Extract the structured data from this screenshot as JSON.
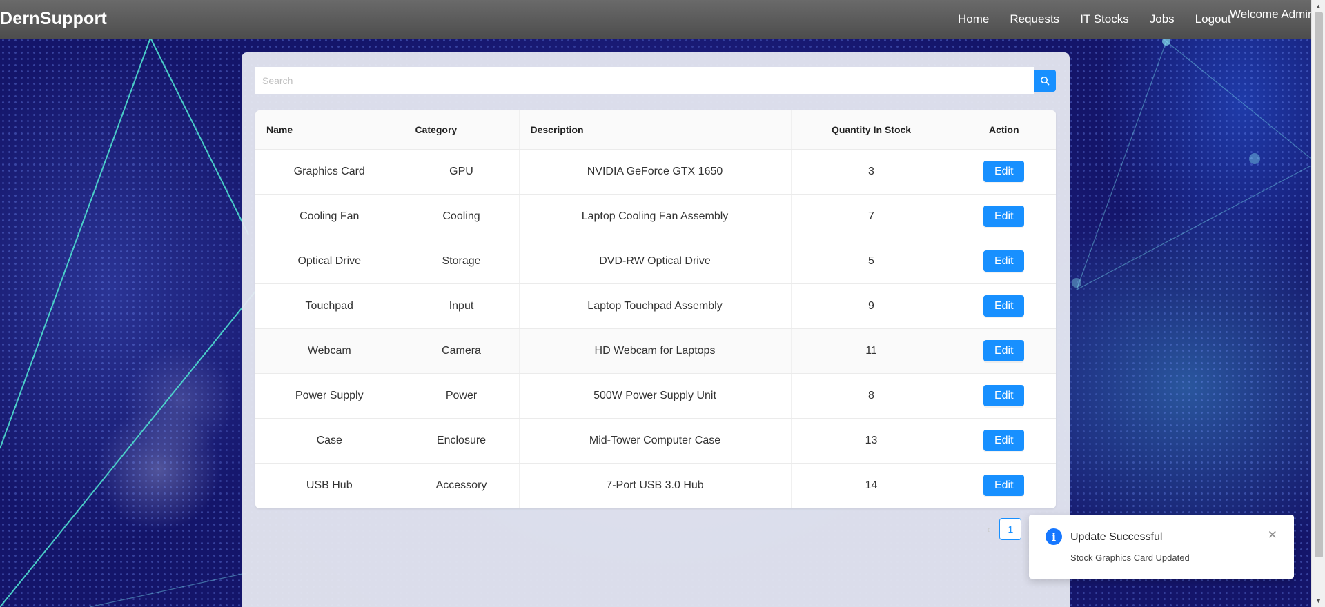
{
  "header": {
    "brand": "DernSupport",
    "nav": [
      "Home",
      "Requests",
      "IT Stocks",
      "Jobs",
      "Logout"
    ],
    "welcome": "Welcome Admin"
  },
  "search": {
    "placeholder": "Search",
    "value": "",
    "button_icon": "search-icon"
  },
  "table": {
    "columns": [
      "Name",
      "Category",
      "Description",
      "Quantity In Stock",
      "Action"
    ],
    "rows": [
      {
        "name": "Graphics Card",
        "category": "GPU",
        "description": "NVIDIA GeForce GTX 1650",
        "quantity": "3",
        "action": "Edit"
      },
      {
        "name": "Cooling Fan",
        "category": "Cooling",
        "description": "Laptop Cooling Fan Assembly",
        "quantity": "7",
        "action": "Edit"
      },
      {
        "name": "Optical Drive",
        "category": "Storage",
        "description": "DVD-RW Optical Drive",
        "quantity": "5",
        "action": "Edit"
      },
      {
        "name": "Touchpad",
        "category": "Input",
        "description": "Laptop Touchpad Assembly",
        "quantity": "9",
        "action": "Edit"
      },
      {
        "name": "Webcam",
        "category": "Camera",
        "description": "HD Webcam for Laptops",
        "quantity": "11",
        "action": "Edit"
      },
      {
        "name": "Power Supply",
        "category": "Power",
        "description": "500W Power Supply Unit",
        "quantity": "8",
        "action": "Edit"
      },
      {
        "name": "Case",
        "category": "Enclosure",
        "description": "Mid-Tower Computer Case",
        "quantity": "13",
        "action": "Edit"
      },
      {
        "name": "USB Hub",
        "category": "Accessory",
        "description": "7-Port USB 3.0 Hub",
        "quantity": "14",
        "action": "Edit"
      }
    ]
  },
  "pagination": {
    "prev": "‹",
    "current": "1"
  },
  "notification": {
    "icon": "info-icon",
    "title": "Update Successful",
    "description": "Stock Graphics Card Updated",
    "close": "✕"
  },
  "colors": {
    "primary": "#1890ff",
    "navbar": "#5a5a5a",
    "info": "#1677ff"
  }
}
